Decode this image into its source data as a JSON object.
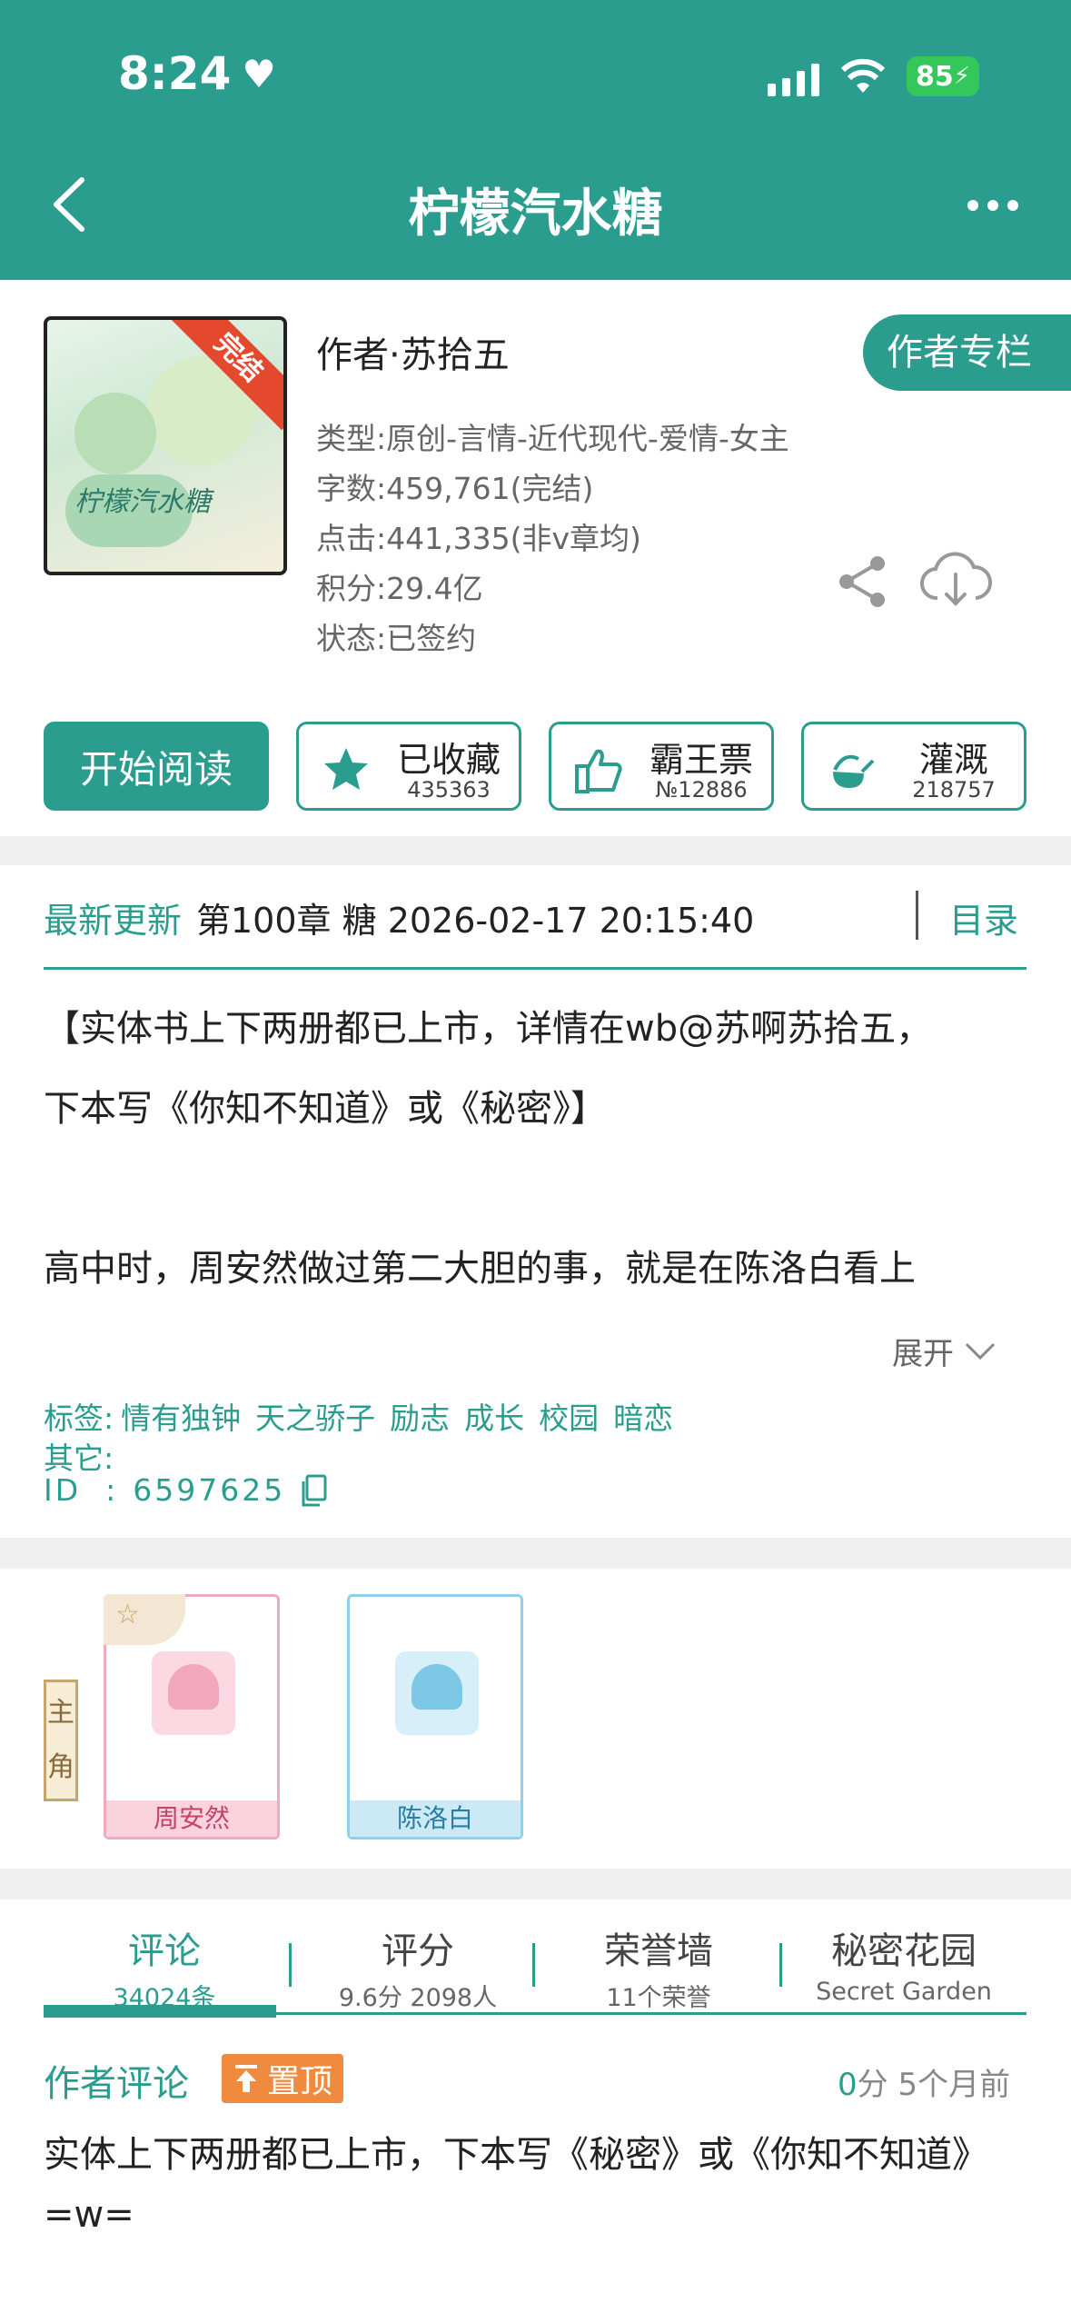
{
  "status_bar": {
    "time": "8:24",
    "battery": "85"
  },
  "header": {
    "title": "柠檬汽水糖"
  },
  "book": {
    "cover_badge": "完结",
    "cover_title": "柠檬汽水糖",
    "author": "作者·苏拾五",
    "author_column_label": "作者专栏",
    "meta": [
      "类型:原创-言情-近代现代-爱情-女主",
      "字数:459,761(完结)",
      "点击:441,335(非v章均)",
      "积分:29.4亿",
      "状态:已签约"
    ]
  },
  "actions": {
    "read_label": "开始阅读",
    "favorite": {
      "label": "已收藏",
      "count": "435363"
    },
    "vote": {
      "label": "霸王票",
      "count": "№12886"
    },
    "water": {
      "label": "灌溉",
      "count": "218757"
    }
  },
  "update": {
    "label": "最新更新",
    "text": "第100章 糖 2026-02-17 20:15:40",
    "toc_label": "目录"
  },
  "summary": {
    "line1": "【实体书上下两册都已上市，详情在wb@苏啊苏拾五，",
    "line2": "下本写《你知不知道》或《秘密》】",
    "line3": "高中时，周安然做过第二大胆的事，就是在陈洛白看上",
    "expand_label": "展开"
  },
  "tags": {
    "label": "标签:",
    "items": [
      "情有独钟",
      "天之骄子",
      "励志",
      "成长",
      "校园",
      "暗恋"
    ],
    "other_label": "其它:",
    "id_label": "ID  :",
    "id_value": "6597625"
  },
  "characters": {
    "role_label": "主角",
    "items": [
      {
        "name": "周安然"
      },
      {
        "name": "陈洛白"
      }
    ]
  },
  "tabs": [
    {
      "label": "评论",
      "sub": "34024条"
    },
    {
      "label": "评分",
      "sub": "9.6分 2098人"
    },
    {
      "label": "荣誉墙",
      "sub": "11个荣誉"
    },
    {
      "label": "秘密花园",
      "sub": "Secret Garden"
    }
  ],
  "author_comment": {
    "label": "作者评论",
    "pin_label": "置顶",
    "score": "0",
    "score_suffix": "分 5个月前",
    "text": "实体上下两册都已上市，下本写《秘密》或《你知不知道》=w="
  },
  "colors": {
    "primary": "#2a9d8f",
    "pin": "#f08a3e",
    "ribbon": "#e4492e"
  }
}
